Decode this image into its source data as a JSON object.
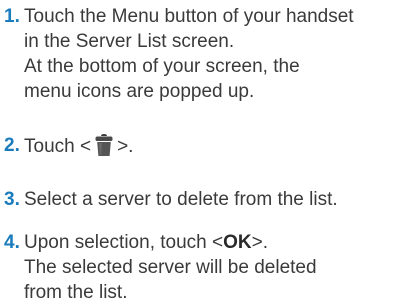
{
  "steps": [
    {
      "number": "1.",
      "lines": [
        "Touch the Menu button of your handset",
        "in the Server List screen.",
        "At the bottom of your screen, the",
        "menu icons are popped up."
      ]
    },
    {
      "number": "2.",
      "prefix": "Touch <",
      "icon": "trash-can-icon",
      "suffix": ">."
    },
    {
      "number": "3.",
      "lines": [
        "Select a server to delete from the list."
      ]
    },
    {
      "number": "4.",
      "line1_prefix": "Upon selection, touch <",
      "line1_bold": "OK",
      "line1_suffix": ">.",
      "lines": [
        "The selected server will be deleted",
        "from the list."
      ]
    }
  ],
  "colors": {
    "step_number": "#1a7bbd",
    "body_text": "#3a3a3a"
  }
}
